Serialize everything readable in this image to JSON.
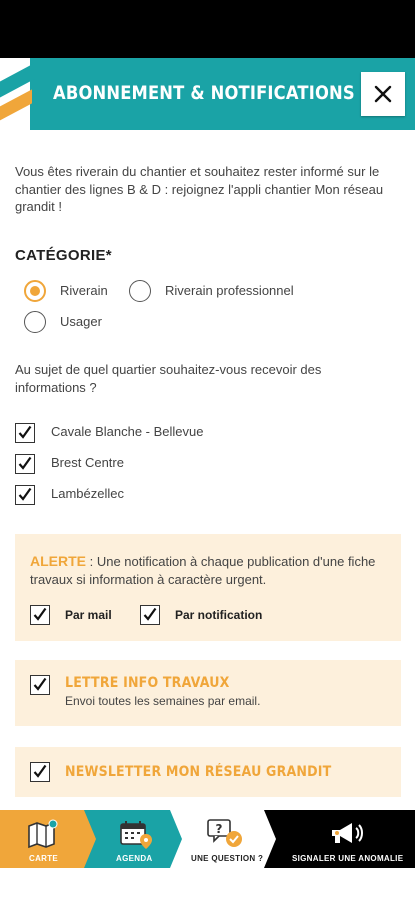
{
  "header": {
    "title": "ABONNEMENT & NOTIFICATIONS"
  },
  "intro": "Vous êtes riverain du chantier et souhaitez rester informé sur le chantier des lignes B & D : rejoignez l'appli chantier Mon réseau grandit !",
  "category": {
    "title": "CATÉGORIE*",
    "options": [
      {
        "label": "Riverain",
        "selected": true
      },
      {
        "label": "Riverain professionnel",
        "selected": false
      },
      {
        "label": "Usager",
        "selected": false
      }
    ]
  },
  "districts": {
    "question": "Au sujet de quel quartier souhaitez-vous recevoir des informations ?",
    "items": [
      {
        "label": "Cavale Blanche - Bellevue",
        "checked": true
      },
      {
        "label": "Brest Centre",
        "checked": true
      },
      {
        "label": "Lambézellec",
        "checked": true
      }
    ]
  },
  "alert": {
    "keyword": "ALERTE",
    "text": " : Une notification à chaque publication d'une fiche travaux si information à caractère urgent.",
    "by_mail": "Par mail",
    "by_notification": "Par notification"
  },
  "lettre": {
    "title": "LETTRE INFO TRAVAUX",
    "subtitle": "Envoi toutes les semaines par email."
  },
  "newsletter": {
    "title": "NEWSLETTER MON RÉSEAU GRANDIT"
  },
  "tabs": [
    {
      "label": "CARTE",
      "icon": "map-icon",
      "bg": "#f0a63a"
    },
    {
      "label": "AGENDA",
      "icon": "calendar-icon",
      "bg": "#1aa3a6"
    },
    {
      "label": "UNE QUESTION ?",
      "icon": "question-icon",
      "bg": "#ffffff"
    },
    {
      "label": "SIGNALER UNE ANOMALIE",
      "icon": "megaphone-icon",
      "bg": "#000000"
    }
  ],
  "colors": {
    "teal": "#1aa3a6",
    "orange": "#f0a63a",
    "panel": "#fdf0dc"
  }
}
